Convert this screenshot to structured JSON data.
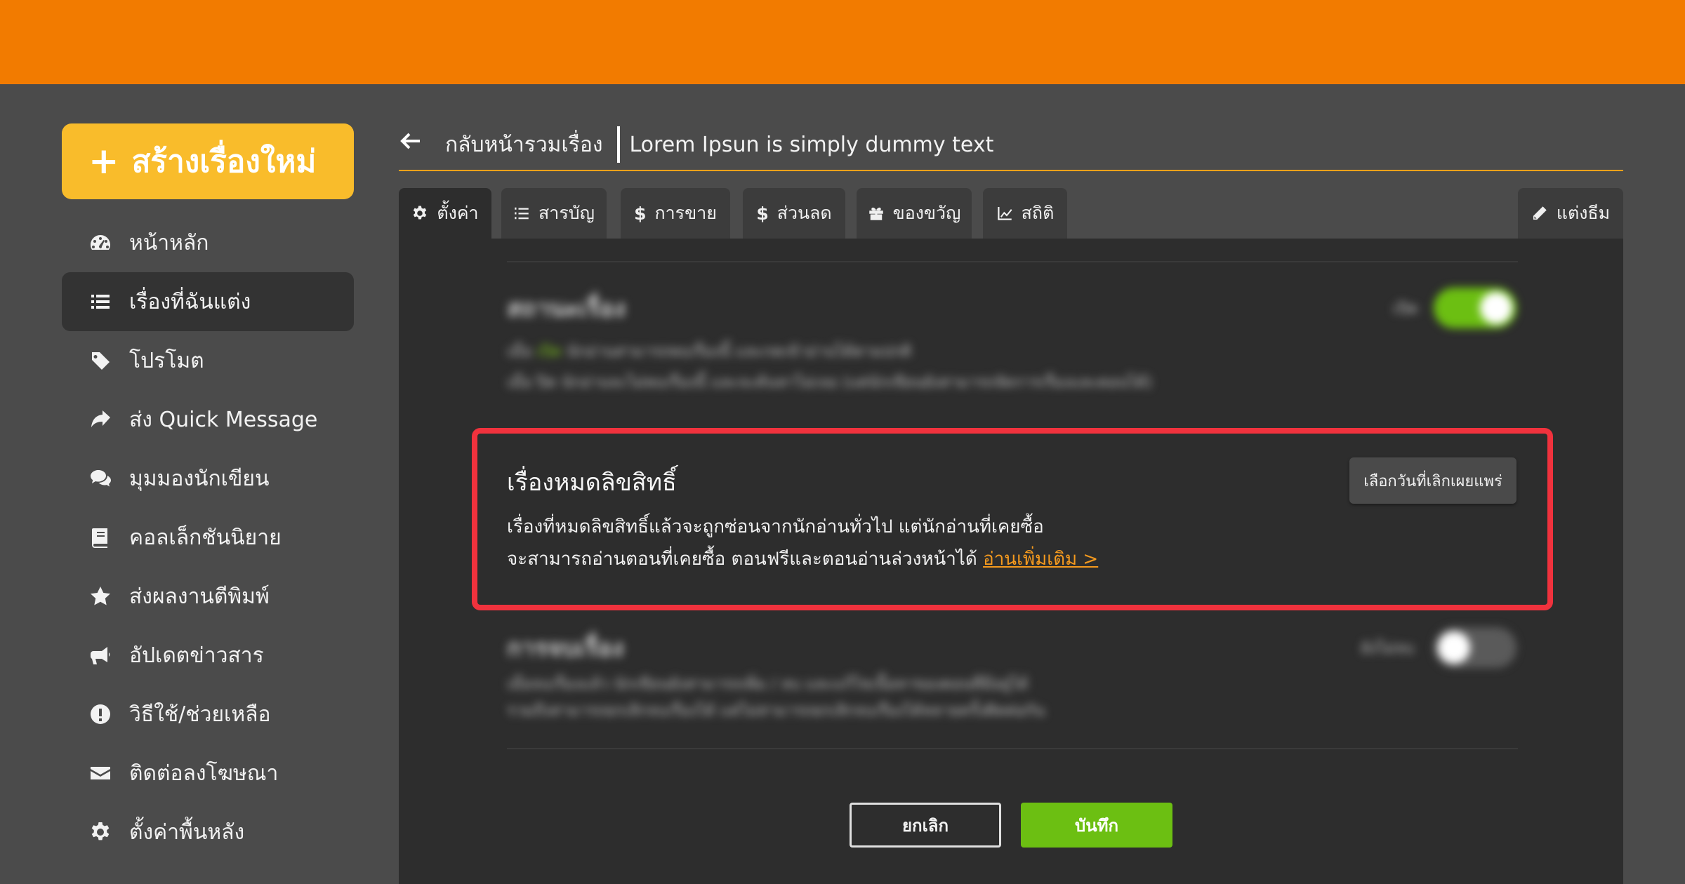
{
  "sidebar": {
    "create_label": "สร้างเรื่องใหม่",
    "items": [
      {
        "label": "หน้าหลัก",
        "icon": "dashboard-icon"
      },
      {
        "label": "เรื่องที่ฉันแต่ง",
        "icon": "list-icon",
        "active": true
      },
      {
        "label": "โปรโมต",
        "icon": "tag-icon"
      },
      {
        "label": "ส่ง Quick Message",
        "icon": "share-icon"
      },
      {
        "label": "มุมมองนักเขียน",
        "icon": "comments-icon"
      },
      {
        "label": "คอลเล็กชันนิยาย",
        "icon": "book-icon"
      },
      {
        "label": "ส่งผลงานตีพิมพ์",
        "icon": "star-icon"
      },
      {
        "label": "อัปเดตข่าวสาร",
        "icon": "megaphone-icon"
      },
      {
        "label": "วิธีใช้/ช่วยเหลือ",
        "icon": "exclamation-icon"
      },
      {
        "label": "ติดต่อลงโฆษณา",
        "icon": "envelope-icon"
      },
      {
        "label": "ตั้งค่าพื้นหลัง",
        "icon": "gear-icon"
      }
    ]
  },
  "header": {
    "back_label": "กลับหน้ารวมเรื่อง",
    "story_title": "Lorem Ipsun is simply dummy text"
  },
  "tabs": [
    {
      "label": "ตั้งค่า",
      "icon": "gear-icon"
    },
    {
      "label": "สารบัญ",
      "icon": "list-ol-icon"
    },
    {
      "label": "การขาย",
      "icon": "dollar-icon"
    },
    {
      "label": "ส่วนลด",
      "icon": "dollar-icon"
    },
    {
      "label": "ของขวัญ",
      "icon": "gift-icon"
    },
    {
      "label": "สถิติ",
      "icon": "chart-icon"
    },
    {
      "label": "แต่งธีม",
      "icon": "pencil-icon"
    }
  ],
  "status_section": {
    "title": "สถานะเรื่อง",
    "toggle_label": "เปิด",
    "desc_line1_prefix": "เมื่อ",
    "desc_line1_hl": "เปิด",
    "desc_line1_rest": "นักอ่านสามารถพบเรื่องนี้ และกดเข้าอ่านได้ตามปกติ",
    "desc_line2": "เมื่อ ปิด นักอ่านจะไม่พบเรื่องนี้ และจะค้นหาไม่เจอ (แต่นักเขียนยังสามารถจัดการเรื่องและตอนได้)",
    "toggle_on": true,
    "toggle_color": "#6cbf12"
  },
  "copyright_section": {
    "title": "เรื่องหมดลิขสิทธิ์",
    "desc_line1": "เรื่องที่หมดลิขสิทธิ์แล้วจะถูกซ่อนจากนักอ่านทั่วไป แต่นักอ่านที่เคยซื้อ",
    "desc_line2": "จะสามารถอ่านตอนที่เคยซื้อ ตอนฟรีและตอนอ่านล่วงหน้าได้",
    "read_more": "อ่านเพิ่มเติม >",
    "pick_date_label": "เลือกวันที่เลิกเผยแพร่",
    "highlight_color": "#f0323d"
  },
  "ending_section": {
    "title": "การจบเรื่อง",
    "toggle_label": "ยังไม่จบ",
    "desc_line1": "เมื่อจบเรื่องแล้ว นักเขียนยังสามารถเพิ่ม / ลบ และแก้ไขเนื้อหาของตอนที่มีอยู่ได้",
    "desc_line2": "รวมถึงสามารถยกเลิกจบเรื่องได้ แต่ไม่สามารถยกเลิกจบเรื่องได้หลายครั้งติดต่อกัน",
    "toggle_on": false
  },
  "actions": {
    "cancel_label": "ยกเลิก",
    "save_label": "บันทึก"
  }
}
